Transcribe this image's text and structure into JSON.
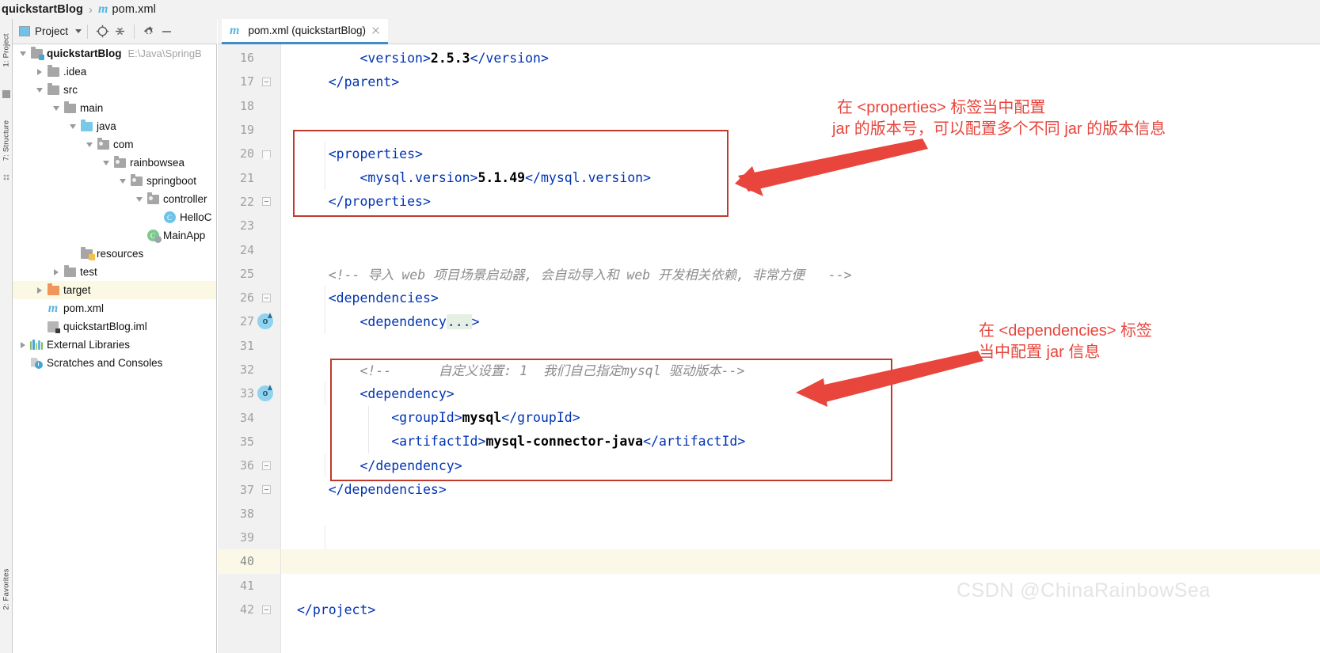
{
  "breadcrumb": {
    "project": "quickstartBlog",
    "separator": "›",
    "file": "pom.xml",
    "file_icon": "maven-m-icon"
  },
  "left_strip": {
    "project_tab": "1: Project",
    "structure_tab": "7: Structure",
    "favorites_tab": "2: Favorites"
  },
  "project_toolbar": {
    "title": "Project",
    "dropdown_icon": "chevron-down-icon",
    "locate_icon": "target-icon",
    "collapse_icon": "collapse-all-icon",
    "settings_icon": "gear-icon",
    "hide_icon": "minimize-icon"
  },
  "tree": [
    {
      "indent": 0,
      "arrow": "down",
      "icon": "folder-module",
      "label": "quickstartBlog",
      "bold": true,
      "path": "E:\\Java\\SpringB",
      "selected": false
    },
    {
      "indent": 1,
      "arrow": "right",
      "icon": "folder-gray",
      "label": ".idea",
      "bold": false,
      "path": "",
      "selected": false
    },
    {
      "indent": 1,
      "arrow": "down",
      "icon": "folder-gray",
      "label": "src",
      "bold": false,
      "path": "",
      "selected": false
    },
    {
      "indent": 2,
      "arrow": "down",
      "icon": "folder-gray",
      "label": "main",
      "bold": false,
      "path": "",
      "selected": false
    },
    {
      "indent": 3,
      "arrow": "down",
      "icon": "folder-blue",
      "label": "java",
      "bold": false,
      "path": "",
      "selected": false
    },
    {
      "indent": 4,
      "arrow": "down",
      "icon": "folder-package",
      "label": "com",
      "bold": false,
      "path": "",
      "selected": false
    },
    {
      "indent": 5,
      "arrow": "down",
      "icon": "folder-package",
      "label": "rainbowsea",
      "bold": false,
      "path": "",
      "selected": false
    },
    {
      "indent": 6,
      "arrow": "down",
      "icon": "folder-package",
      "label": "springboot",
      "bold": false,
      "path": "",
      "selected": false
    },
    {
      "indent": 7,
      "arrow": "down",
      "icon": "folder-package",
      "label": "controller",
      "bold": false,
      "path": "",
      "selected": false
    },
    {
      "indent": 8,
      "arrow": "none",
      "icon": "class-icon",
      "label": "HelloC",
      "bold": false,
      "path": "",
      "selected": false
    },
    {
      "indent": 7,
      "arrow": "none",
      "icon": "class-run-icon",
      "label": "MainApp",
      "bold": false,
      "path": "",
      "selected": false
    },
    {
      "indent": 3,
      "arrow": "none",
      "icon": "folder-resources",
      "label": "resources",
      "bold": false,
      "path": "",
      "selected": false
    },
    {
      "indent": 2,
      "arrow": "right",
      "icon": "folder-gray",
      "label": "test",
      "bold": false,
      "path": "",
      "selected": false
    },
    {
      "indent": 1,
      "arrow": "right",
      "icon": "folder-orange",
      "label": "target",
      "bold": false,
      "path": "",
      "selected": true
    },
    {
      "indent": 1,
      "arrow": "none",
      "icon": "maven-m-icon",
      "label": "pom.xml",
      "bold": false,
      "path": "",
      "selected": false
    },
    {
      "indent": 1,
      "arrow": "none",
      "icon": "iml-icon",
      "label": "quickstartBlog.iml",
      "bold": false,
      "path": "",
      "selected": false
    },
    {
      "indent": 0,
      "arrow": "right",
      "icon": "libraries-icon",
      "label": "External Libraries",
      "bold": false,
      "path": "",
      "selected": false
    },
    {
      "indent": 0,
      "arrow": "none",
      "icon": "scratches-icon",
      "label": "Scratches and Consoles",
      "bold": false,
      "path": "",
      "selected": false
    }
  ],
  "editor_tab": {
    "icon": "maven-m-icon",
    "label": "pom.xml (quickstartBlog)",
    "close_icon": "close-icon"
  },
  "editor": {
    "lines": [
      {
        "num": "16",
        "fold": "none",
        "overlay": "",
        "current": false,
        "segments": [
          {
            "t": "        ",
            "c": "plain"
          },
          {
            "t": "<version>",
            "c": "tag"
          },
          {
            "t": "2.5.3",
            "c": "val"
          },
          {
            "t": "</version>",
            "c": "tag"
          }
        ]
      },
      {
        "num": "17",
        "fold": "minus",
        "overlay": "",
        "current": false,
        "segments": [
          {
            "t": "    ",
            "c": "plain"
          },
          {
            "t": "</parent>",
            "c": "tag"
          }
        ]
      },
      {
        "num": "18",
        "fold": "none",
        "overlay": "",
        "current": false,
        "segments": []
      },
      {
        "num": "19",
        "fold": "none",
        "overlay": "",
        "current": false,
        "segments": []
      },
      {
        "num": "20",
        "fold": "tip",
        "overlay": "",
        "current": false,
        "segments": [
          {
            "t": "    ",
            "c": "plain"
          },
          {
            "t": "<properties>",
            "c": "tag"
          }
        ]
      },
      {
        "num": "21",
        "fold": "none",
        "overlay": "",
        "current": false,
        "segments": [
          {
            "t": "        ",
            "c": "plain"
          },
          {
            "t": "<mysql.version>",
            "c": "tag"
          },
          {
            "t": "5.1.49",
            "c": "val"
          },
          {
            "t": "</mysql.version>",
            "c": "tag"
          }
        ]
      },
      {
        "num": "22",
        "fold": "minus",
        "overlay": "",
        "current": false,
        "segments": [
          {
            "t": "    ",
            "c": "plain"
          },
          {
            "t": "</properties>",
            "c": "tag"
          }
        ]
      },
      {
        "num": "23",
        "fold": "none",
        "overlay": "",
        "current": false,
        "segments": []
      },
      {
        "num": "24",
        "fold": "none",
        "overlay": "",
        "current": false,
        "segments": []
      },
      {
        "num": "25",
        "fold": "none",
        "overlay": "",
        "current": false,
        "segments": [
          {
            "t": "    <!-- 导入 web 项目场景启动器, 会自动导入和 web 开发相关依赖, 非常方便   -->",
            "c": "cmt"
          }
        ]
      },
      {
        "num": "26",
        "fold": "minus",
        "overlay": "",
        "current": false,
        "segments": [
          {
            "t": "    ",
            "c": "plain"
          },
          {
            "t": "<dependencies>",
            "c": "tag"
          }
        ]
      },
      {
        "num": "27",
        "fold": "plus",
        "overlay": "o",
        "current": false,
        "segments": [
          {
            "t": "        ",
            "c": "plain"
          },
          {
            "t": "<dependency",
            "c": "tag"
          },
          {
            "t": "...",
            "c": "fold"
          },
          {
            "t": ">",
            "c": "tag"
          }
        ]
      },
      {
        "num": "31",
        "fold": "none",
        "overlay": "",
        "current": false,
        "segments": []
      },
      {
        "num": "32",
        "fold": "none",
        "overlay": "",
        "current": false,
        "segments": [
          {
            "t": "        <!--      自定义设置: 1  我们自己指定mysql 驱动版本-->",
            "c": "cmt"
          }
        ]
      },
      {
        "num": "33",
        "fold": "tip",
        "overlay": "o",
        "current": false,
        "segments": [
          {
            "t": "        ",
            "c": "plain"
          },
          {
            "t": "<dependency>",
            "c": "tag"
          }
        ]
      },
      {
        "num": "34",
        "fold": "none",
        "overlay": "",
        "current": false,
        "segments": [
          {
            "t": "            ",
            "c": "plain"
          },
          {
            "t": "<groupId>",
            "c": "tag"
          },
          {
            "t": "mysql",
            "c": "val"
          },
          {
            "t": "</groupId>",
            "c": "tag"
          }
        ]
      },
      {
        "num": "35",
        "fold": "none",
        "overlay": "",
        "current": false,
        "segments": [
          {
            "t": "            ",
            "c": "plain"
          },
          {
            "t": "<artifactId>",
            "c": "tag"
          },
          {
            "t": "mysql-connector-java",
            "c": "val"
          },
          {
            "t": "</artifactId>",
            "c": "tag"
          }
        ]
      },
      {
        "num": "36",
        "fold": "minus",
        "overlay": "",
        "current": false,
        "segments": [
          {
            "t": "        ",
            "c": "plain"
          },
          {
            "t": "</dependency>",
            "c": "tag"
          }
        ]
      },
      {
        "num": "37",
        "fold": "minus",
        "overlay": "",
        "current": false,
        "segments": [
          {
            "t": "    ",
            "c": "plain"
          },
          {
            "t": "</dependencies>",
            "c": "tag"
          }
        ]
      },
      {
        "num": "38",
        "fold": "none",
        "overlay": "",
        "current": false,
        "segments": []
      },
      {
        "num": "39",
        "fold": "none",
        "overlay": "",
        "current": false,
        "segments": []
      },
      {
        "num": "40",
        "fold": "none",
        "overlay": "",
        "current": true,
        "segments": []
      },
      {
        "num": "41",
        "fold": "none",
        "overlay": "",
        "current": false,
        "segments": []
      },
      {
        "num": "42",
        "fold": "minus",
        "overlay": "",
        "current": false,
        "segments": [
          {
            "t": "",
            "c": "plain"
          },
          {
            "t": "</project>",
            "c": "tag"
          }
        ]
      }
    ]
  },
  "annotations": {
    "color": "#e8453c",
    "box_color": "#c0392b",
    "note1_line1": "在 <properties> 标签当中配置",
    "note1_line2": "jar 的版本号，可以配置多个不同 jar 的版本信息",
    "note2_line1": "在 <dependencies> 标签",
    "note2_line2": "当中配置 jar 信息",
    "arrow1_name": "annotation-arrow-properties",
    "arrow2_name": "annotation-arrow-dependencies"
  },
  "watermark": "CSDN @ChinaRainbowSea"
}
